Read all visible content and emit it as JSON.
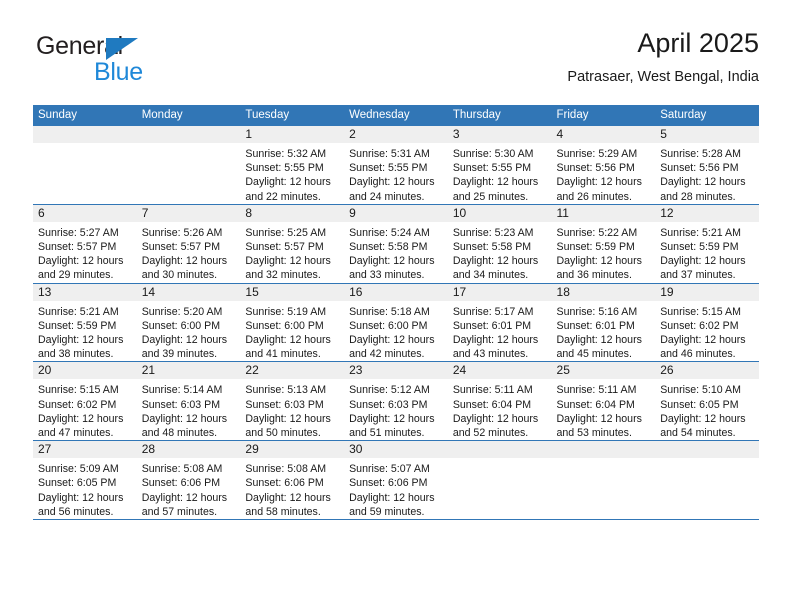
{
  "brand": {
    "line1": "General",
    "line2": "Blue",
    "triangle_color": "#1f7ac0",
    "blue_text_color": "#1f88d8"
  },
  "header": {
    "title": "April 2025",
    "location": "Patrasaer, West Bengal, India"
  },
  "theme": {
    "header_blue": "#3176b6",
    "daynum_band_gray": "#efefef",
    "row_rule_blue": "#3176b6"
  },
  "calendar": {
    "weekday_headers": [
      "Sunday",
      "Monday",
      "Tuesday",
      "Wednesday",
      "Thursday",
      "Friday",
      "Saturday"
    ],
    "labels": {
      "sunrise_prefix": "Sunrise:",
      "sunset_prefix": "Sunset:",
      "daylight_prefix": "Daylight:"
    },
    "weeks": [
      [
        {
          "empty": true
        },
        {
          "empty": true
        },
        {
          "day": "1",
          "sunrise": "Sunrise: 5:32 AM",
          "sunset": "Sunset: 5:55 PM",
          "daylight_l1": "Daylight: 12 hours",
          "daylight_l2": "and 22 minutes."
        },
        {
          "day": "2",
          "sunrise": "Sunrise: 5:31 AM",
          "sunset": "Sunset: 5:55 PM",
          "daylight_l1": "Daylight: 12 hours",
          "daylight_l2": "and 24 minutes."
        },
        {
          "day": "3",
          "sunrise": "Sunrise: 5:30 AM",
          "sunset": "Sunset: 5:55 PM",
          "daylight_l1": "Daylight: 12 hours",
          "daylight_l2": "and 25 minutes."
        },
        {
          "day": "4",
          "sunrise": "Sunrise: 5:29 AM",
          "sunset": "Sunset: 5:56 PM",
          "daylight_l1": "Daylight: 12 hours",
          "daylight_l2": "and 26 minutes."
        },
        {
          "day": "5",
          "sunrise": "Sunrise: 5:28 AM",
          "sunset": "Sunset: 5:56 PM",
          "daylight_l1": "Daylight: 12 hours",
          "daylight_l2": "and 28 minutes."
        }
      ],
      [
        {
          "day": "6",
          "sunrise": "Sunrise: 5:27 AM",
          "sunset": "Sunset: 5:57 PM",
          "daylight_l1": "Daylight: 12 hours",
          "daylight_l2": "and 29 minutes."
        },
        {
          "day": "7",
          "sunrise": "Sunrise: 5:26 AM",
          "sunset": "Sunset: 5:57 PM",
          "daylight_l1": "Daylight: 12 hours",
          "daylight_l2": "and 30 minutes."
        },
        {
          "day": "8",
          "sunrise": "Sunrise: 5:25 AM",
          "sunset": "Sunset: 5:57 PM",
          "daylight_l1": "Daylight: 12 hours",
          "daylight_l2": "and 32 minutes."
        },
        {
          "day": "9",
          "sunrise": "Sunrise: 5:24 AM",
          "sunset": "Sunset: 5:58 PM",
          "daylight_l1": "Daylight: 12 hours",
          "daylight_l2": "and 33 minutes."
        },
        {
          "day": "10",
          "sunrise": "Sunrise: 5:23 AM",
          "sunset": "Sunset: 5:58 PM",
          "daylight_l1": "Daylight: 12 hours",
          "daylight_l2": "and 34 minutes."
        },
        {
          "day": "11",
          "sunrise": "Sunrise: 5:22 AM",
          "sunset": "Sunset: 5:59 PM",
          "daylight_l1": "Daylight: 12 hours",
          "daylight_l2": "and 36 minutes."
        },
        {
          "day": "12",
          "sunrise": "Sunrise: 5:21 AM",
          "sunset": "Sunset: 5:59 PM",
          "daylight_l1": "Daylight: 12 hours",
          "daylight_l2": "and 37 minutes."
        }
      ],
      [
        {
          "day": "13",
          "sunrise": "Sunrise: 5:21 AM",
          "sunset": "Sunset: 5:59 PM",
          "daylight_l1": "Daylight: 12 hours",
          "daylight_l2": "and 38 minutes."
        },
        {
          "day": "14",
          "sunrise": "Sunrise: 5:20 AM",
          "sunset": "Sunset: 6:00 PM",
          "daylight_l1": "Daylight: 12 hours",
          "daylight_l2": "and 39 minutes."
        },
        {
          "day": "15",
          "sunrise": "Sunrise: 5:19 AM",
          "sunset": "Sunset: 6:00 PM",
          "daylight_l1": "Daylight: 12 hours",
          "daylight_l2": "and 41 minutes."
        },
        {
          "day": "16",
          "sunrise": "Sunrise: 5:18 AM",
          "sunset": "Sunset: 6:00 PM",
          "daylight_l1": "Daylight: 12 hours",
          "daylight_l2": "and 42 minutes."
        },
        {
          "day": "17",
          "sunrise": "Sunrise: 5:17 AM",
          "sunset": "Sunset: 6:01 PM",
          "daylight_l1": "Daylight: 12 hours",
          "daylight_l2": "and 43 minutes."
        },
        {
          "day": "18",
          "sunrise": "Sunrise: 5:16 AM",
          "sunset": "Sunset: 6:01 PM",
          "daylight_l1": "Daylight: 12 hours",
          "daylight_l2": "and 45 minutes."
        },
        {
          "day": "19",
          "sunrise": "Sunrise: 5:15 AM",
          "sunset": "Sunset: 6:02 PM",
          "daylight_l1": "Daylight: 12 hours",
          "daylight_l2": "and 46 minutes."
        }
      ],
      [
        {
          "day": "20",
          "sunrise": "Sunrise: 5:15 AM",
          "sunset": "Sunset: 6:02 PM",
          "daylight_l1": "Daylight: 12 hours",
          "daylight_l2": "and 47 minutes."
        },
        {
          "day": "21",
          "sunrise": "Sunrise: 5:14 AM",
          "sunset": "Sunset: 6:03 PM",
          "daylight_l1": "Daylight: 12 hours",
          "daylight_l2": "and 48 minutes."
        },
        {
          "day": "22",
          "sunrise": "Sunrise: 5:13 AM",
          "sunset": "Sunset: 6:03 PM",
          "daylight_l1": "Daylight: 12 hours",
          "daylight_l2": "and 50 minutes."
        },
        {
          "day": "23",
          "sunrise": "Sunrise: 5:12 AM",
          "sunset": "Sunset: 6:03 PM",
          "daylight_l1": "Daylight: 12 hours",
          "daylight_l2": "and 51 minutes."
        },
        {
          "day": "24",
          "sunrise": "Sunrise: 5:11 AM",
          "sunset": "Sunset: 6:04 PM",
          "daylight_l1": "Daylight: 12 hours",
          "daylight_l2": "and 52 minutes."
        },
        {
          "day": "25",
          "sunrise": "Sunrise: 5:11 AM",
          "sunset": "Sunset: 6:04 PM",
          "daylight_l1": "Daylight: 12 hours",
          "daylight_l2": "and 53 minutes."
        },
        {
          "day": "26",
          "sunrise": "Sunrise: 5:10 AM",
          "sunset": "Sunset: 6:05 PM",
          "daylight_l1": "Daylight: 12 hours",
          "daylight_l2": "and 54 minutes."
        }
      ],
      [
        {
          "day": "27",
          "sunrise": "Sunrise: 5:09 AM",
          "sunset": "Sunset: 6:05 PM",
          "daylight_l1": "Daylight: 12 hours",
          "daylight_l2": "and 56 minutes."
        },
        {
          "day": "28",
          "sunrise": "Sunrise: 5:08 AM",
          "sunset": "Sunset: 6:06 PM",
          "daylight_l1": "Daylight: 12 hours",
          "daylight_l2": "and 57 minutes."
        },
        {
          "day": "29",
          "sunrise": "Sunrise: 5:08 AM",
          "sunset": "Sunset: 6:06 PM",
          "daylight_l1": "Daylight: 12 hours",
          "daylight_l2": "and 58 minutes."
        },
        {
          "day": "30",
          "sunrise": "Sunrise: 5:07 AM",
          "sunset": "Sunset: 6:06 PM",
          "daylight_l1": "Daylight: 12 hours",
          "daylight_l2": "and 59 minutes."
        },
        {
          "empty": true
        },
        {
          "empty": true
        },
        {
          "empty": true
        }
      ]
    ]
  }
}
